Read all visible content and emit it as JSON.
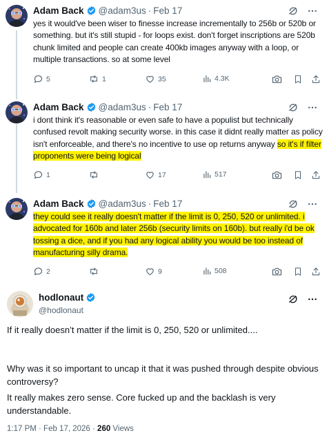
{
  "replies": [
    {
      "name": "Adam Back",
      "handle": "@adam3us",
      "dot": "·",
      "date": "Feb 17",
      "text_plain": "yes it would've been wiser to finesse increase incrementally to 256b or 520b or something. but it's still stupid - for loops exist. don't forget inscriptions are 520b chunk limited and people can create 400kb images anyway with a loop, or multiple transactions. so at some level",
      "text_highlight": "",
      "stats": {
        "replies": "5",
        "reposts": "1",
        "likes": "35",
        "views": "4.3K"
      }
    },
    {
      "name": "Adam Back",
      "handle": "@adam3us",
      "dot": "·",
      "date": "Feb 17",
      "text_plain": "i dont think it's reasonable or even safe to have a populist but technically confused revolt making security worse. in this case it didnt really matter as policy isn't enforceable, and there's no incentive to use op returns anyway ",
      "text_highlight": "so it's if filter proponents were being logical",
      "stats": {
        "replies": "1",
        "reposts": "",
        "likes": "17",
        "views": "517"
      }
    },
    {
      "name": "Adam Back",
      "handle": "@adam3us",
      "dot": "·",
      "date": "Feb 17",
      "text_plain": "",
      "text_highlight": "they could see it really doesn't matter if the limit is 0, 250, 520 or unlimited. i advocated for 160b and later 256b (security limits on 160b). but really i'd be ok tossing a dice, and if you had any logical ability you would be too instead of manufacturing silly drama.",
      "stats": {
        "replies": "2",
        "reposts": "",
        "likes": "9",
        "views": "508"
      }
    }
  ],
  "main": {
    "name": "hodlonaut",
    "handle": "@hodlonaut",
    "paragraphs": [
      "If it really doesn’t matter if the limit is 0, 250, 520 or unlimited....",
      "Why was it so important to uncap it that it was pushed through despite obvious controversy?",
      "It really makes zero sense. Core fucked up and the backlash is very understandable."
    ],
    "time": "1:17 PM · Feb 17, 2026 · ",
    "views_count": "260",
    "views_label": " Views"
  },
  "icons": {
    "verified": "verified-badge-icon",
    "grok": "grok-icon",
    "more": "more-icon",
    "reply": "reply-icon",
    "repost": "repost-icon",
    "like": "like-icon",
    "views": "views-icon",
    "camera": "camera-icon",
    "bookmark": "bookmark-icon",
    "share": "share-icon"
  },
  "colors": {
    "verified": "#1d9bf0",
    "highlight": "#fff200",
    "secondary_text": "#536471"
  }
}
